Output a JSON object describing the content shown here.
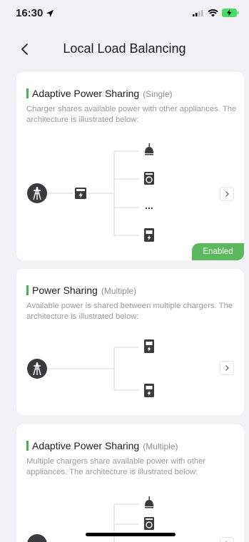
{
  "status_bar": {
    "time": "16:30"
  },
  "nav": {
    "title": "Local Load Balancing"
  },
  "cards": [
    {
      "title": "Adaptive Power Sharing",
      "subtitle": "(Single)",
      "description": "Charger shares available power with other appliances. The architecture is illustrated below:",
      "badge": "Enabled",
      "ellipsis": "..."
    },
    {
      "title": "Power Sharing",
      "subtitle": "(Multiple)",
      "description": "Available power is shared between multiple chargers. The architecture is illustrated below:"
    },
    {
      "title": "Adaptive Power Sharing",
      "subtitle": "(Multiple)",
      "description": "Multiple chargers share available power with other appliances. The architecture is illustrated below:"
    }
  ],
  "colors": {
    "accent_green": "#5cb85c",
    "icon_dark": "#3b3b3d",
    "line": "#d9d9dc"
  },
  "icons": [
    "location-arrow-icon",
    "signal-icon",
    "wifi-icon",
    "battery-charging-icon",
    "back-chevron-icon",
    "power-tower-icon",
    "meter-icon",
    "lamp-icon",
    "washer-icon",
    "charger-icon",
    "chevron-right-icon"
  ]
}
